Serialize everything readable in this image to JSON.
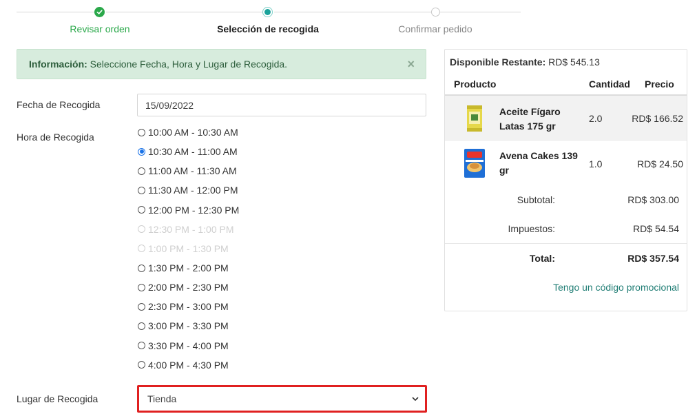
{
  "stepper": {
    "steps": [
      {
        "label": "Revisar orden",
        "state": "done"
      },
      {
        "label": "Selección de recogida",
        "state": "active"
      },
      {
        "label": "Confirmar pedido",
        "state": "pending"
      }
    ]
  },
  "alert": {
    "title": "Información:",
    "message": "Seleccione Fecha, Hora y Lugar de Recogida.",
    "close_symbol": "×"
  },
  "form": {
    "date_label": "Fecha de Recogida",
    "date_value": "15/09/2022",
    "time_label": "Hora de Recogida",
    "time_slots": [
      {
        "label": "10:00 AM - 10:30 AM",
        "checked": false,
        "disabled": false
      },
      {
        "label": "10:30 AM - 11:00 AM",
        "checked": true,
        "disabled": false
      },
      {
        "label": "11:00 AM - 11:30 AM",
        "checked": false,
        "disabled": false
      },
      {
        "label": "11:30 AM - 12:00 PM",
        "checked": false,
        "disabled": false
      },
      {
        "label": "12:00 PM - 12:30 PM",
        "checked": false,
        "disabled": false
      },
      {
        "label": "12:30 PM - 1:00 PM",
        "checked": false,
        "disabled": true
      },
      {
        "label": "1:00 PM - 1:30 PM",
        "checked": false,
        "disabled": true
      },
      {
        "label": "1:30 PM - 2:00 PM",
        "checked": false,
        "disabled": false
      },
      {
        "label": "2:00 PM - 2:30 PM",
        "checked": false,
        "disabled": false
      },
      {
        "label": "2:30 PM - 3:00 PM",
        "checked": false,
        "disabled": false
      },
      {
        "label": "3:00 PM - 3:30 PM",
        "checked": false,
        "disabled": false
      },
      {
        "label": "3:30 PM - 4:00 PM",
        "checked": false,
        "disabled": false
      },
      {
        "label": "4:00 PM - 4:30 PM",
        "checked": false,
        "disabled": false
      }
    ],
    "place_label": "Lugar de Recogida",
    "place_value": "Tienda"
  },
  "summary": {
    "available_label": "Disponible Restante:",
    "available_value": "RD$ 545.13",
    "headers": {
      "product": "Producto",
      "quantity": "Cantidad",
      "price": "Precio"
    },
    "items": [
      {
        "name": "Aceite Fígaro Latas 175 gr",
        "quantity": "2.0",
        "price": "RD$ 166.52",
        "icon": "oil-can-product-icon"
      },
      {
        "name": "Avena Cakes 139 gr",
        "quantity": "1.0",
        "price": "RD$ 24.50",
        "icon": "cereal-box-product-icon"
      }
    ],
    "subtotal_label": "Subtotal:",
    "subtotal_value": "RD$ 303.00",
    "tax_label": "Impuestos:",
    "tax_value": "RD$ 54.54",
    "total_label": "Total:",
    "total_value": "RD$ 357.54",
    "promo_link": "Tengo un código promocional"
  },
  "colors": {
    "accent_green": "#2aa84a",
    "active_teal": "#1aa39b",
    "alert_bg": "#d7ecdd",
    "highlight_red": "#e02020",
    "link_teal": "#1f7d74"
  }
}
